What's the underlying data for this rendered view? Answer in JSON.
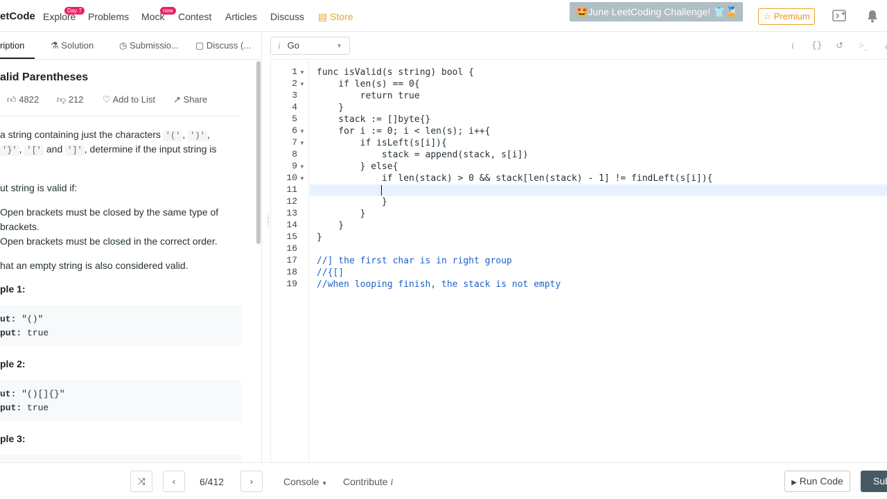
{
  "nav": {
    "logo": "etCode",
    "items": [
      {
        "label": "Explore",
        "badge": "Day 7"
      },
      {
        "label": "Problems"
      },
      {
        "label": "Mock",
        "badge": "new"
      },
      {
        "label": "Contest"
      },
      {
        "label": "Articles"
      },
      {
        "label": "Discuss"
      },
      {
        "label": "Store"
      }
    ],
    "promo": "🤩June LeetCoding Challenge! 👕🏅",
    "promo_close": "×",
    "premium": "☆ Premium"
  },
  "tabs": [
    "ription",
    "Solution",
    "Submissio...",
    "Discuss (..."
  ],
  "problem": {
    "title": "alid Parentheses",
    "likes": "4822",
    "dislikes": "212",
    "add_to_list": "Add to List",
    "share": "Share",
    "desc1_a": "a string containing just the characters ",
    "desc1_c1": "'('",
    "desc1_sep": ", ",
    "desc1_c2": "')'",
    "desc1_end": ",",
    "desc2_c3": "'}'",
    "desc2_c4": "'['",
    "desc2_and": " and ",
    "desc2_c5": "']'",
    "desc2_end": ", determine if the input string is",
    "valid_if": "ut string is valid if:",
    "rule1a": "Open brackets must be closed by the same type of",
    "rule1b": "brackets.",
    "rule2": "Open brackets must be closed in the correct order.",
    "note": "hat an empty string is also considered valid.",
    "examples": [
      {
        "title": "ple 1:",
        "input_label": "ut:",
        "input": " \"()\"",
        "output_label": "put:",
        "output": " true"
      },
      {
        "title": "ple 2:",
        "input_label": "ut:",
        "input": " \"()[]{}\"",
        "output_label": "put:",
        "output": " true"
      },
      {
        "title": "ple 3:"
      }
    ]
  },
  "editor": {
    "language": "Go",
    "lines": [
      "func isValid(s string) bool {",
      "    if len(s) == 0{",
      "        return true",
      "    }",
      "    stack := []byte{}",
      "    for i := 0; i < len(s); i++{",
      "        if isLeft(s[i]){",
      "            stack = append(stack, s[i])",
      "        } else{",
      "            if len(stack) > 0 && stack[len(stack) - 1] != findLeft(s[i]){",
      "            ",
      "            }",
      "        }",
      "    }",
      "}",
      "",
      "//] the first char is in right group",
      "//{[]",
      "//when looping finish, the stack is not empty"
    ]
  },
  "bottom": {
    "pager": "6/412",
    "console": "Console",
    "contribute": "Contribute",
    "run": "Run Code",
    "submit": "Sub"
  }
}
